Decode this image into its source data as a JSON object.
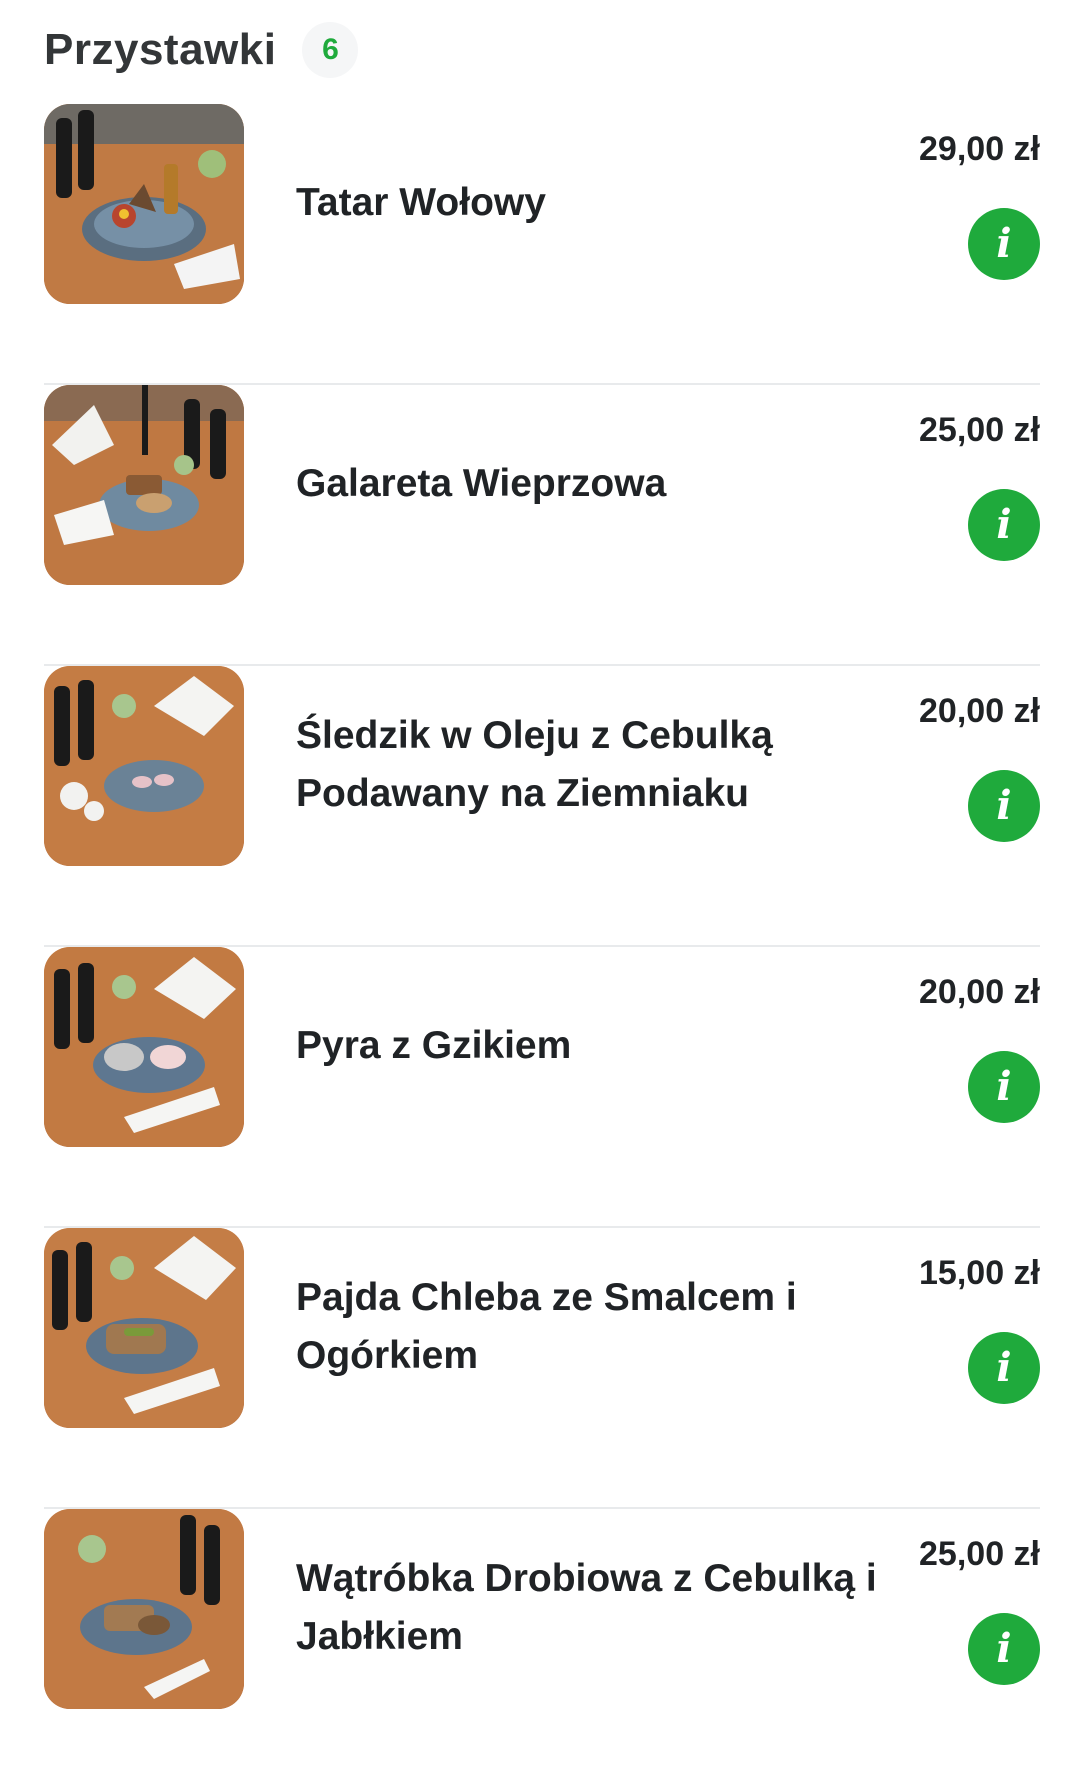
{
  "section": {
    "title": "Przystawki",
    "count": "6"
  },
  "items": [
    {
      "name": "Tatar Wołowy",
      "price": "29,00 zł",
      "photo_icon": "beef-tartare-photo"
    },
    {
      "name": "Galareta Wieprzowa",
      "price": "25,00 zł",
      "photo_icon": "pork-jelly-photo"
    },
    {
      "name": "Śledzik w Oleju z Cebulką Podawany na Ziemniaku",
      "price": "20,00 zł",
      "photo_icon": "herring-photo"
    },
    {
      "name": "Pyra z Gzikiem",
      "price": "20,00 zł",
      "photo_icon": "potato-cottage-cheese-photo"
    },
    {
      "name": "Pajda Chleba ze Smalcem i Ogórkiem",
      "price": "15,00 zł",
      "photo_icon": "bread-lard-photo"
    },
    {
      "name": "Wątróbka Drobiowa z Cebulką i Jabłkiem",
      "price": "25,00 zł",
      "photo_icon": "chicken-liver-photo"
    }
  ],
  "info_icon": "i",
  "colors": {
    "accent": "#1faa3c",
    "text": "#202326",
    "divider": "#e8eaec",
    "badge_bg": "#f5f6f7"
  }
}
